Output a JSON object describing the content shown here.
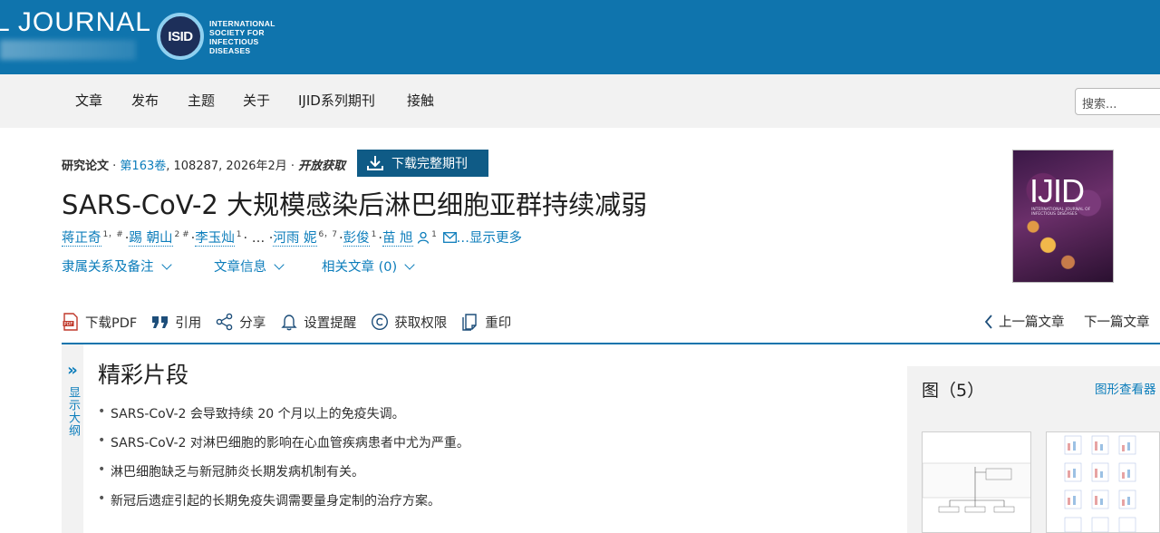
{
  "banner": {
    "journal_wordmark": "L JOURNAL",
    "logo_text": "ISID",
    "society_name": "INTERNATIONAL SOCIETY FOR INFECTIOUS DISEASES",
    "color": "#0f74ad"
  },
  "nav": {
    "items": [
      "文章",
      "发布",
      "主题",
      "关于",
      "IJID系列期刊",
      "接触"
    ],
    "search_placeholder": "搜索..."
  },
  "article": {
    "type": "研究论文",
    "sep1": " · ",
    "volume": "第163卷",
    "rest": ", 108287, 2026年2月 · ",
    "open_access": "开放获取",
    "download_issue": "下载完整期刊",
    "title": "SARS-CoV-2 大规模感染后淋巴细胞亚群持续减弱",
    "authors": [
      {
        "name": "蒋正奇",
        "sup": "1，#"
      },
      {
        "name": "踢 朝山",
        "sup": "2 #"
      },
      {
        "name": "李玉灿",
        "sup": "1"
      },
      {
        "name": "河雨 妮",
        "sup": "6，7"
      },
      {
        "name": "彭俊",
        "sup": "1"
      },
      {
        "name": "苗 旭",
        "sup": "1"
      }
    ],
    "author_ellipsis": "…",
    "show_more": "显示更多",
    "toggles": [
      "隶属关系及备注",
      "文章信息",
      "相关文章 (0)"
    ],
    "cover_title": "IJID",
    "cover_subtitle": "INTERNATIONAL JOURNAL OF INFECTIOUS DISEASES"
  },
  "toolbar": {
    "download_pdf": "下载PDF",
    "cite": "引用",
    "share": "分享",
    "alert": "设置提醒",
    "permissions": "获取权限",
    "reprint": "重印",
    "prev": "上一篇文章",
    "next": "下一篇文章"
  },
  "outline": {
    "label": "显示大纲"
  },
  "highlights": {
    "title": "精彩片段",
    "items": [
      "SARS-CoV-2 会导致持续 20 个月以上的免疫失调。",
      "SARS-CoV-2 对淋巴细胞的影响在心血管疾病患者中尤为严重。",
      "淋巴细胞缺乏与新冠肺炎长期发病机制有关。",
      "新冠后遗症引起的长期免疫失调需要量身定制的治疗方案。"
    ]
  },
  "figures": {
    "title": "图（5）",
    "viewer": "图形查看器",
    "accent": "#0c7dbb"
  }
}
